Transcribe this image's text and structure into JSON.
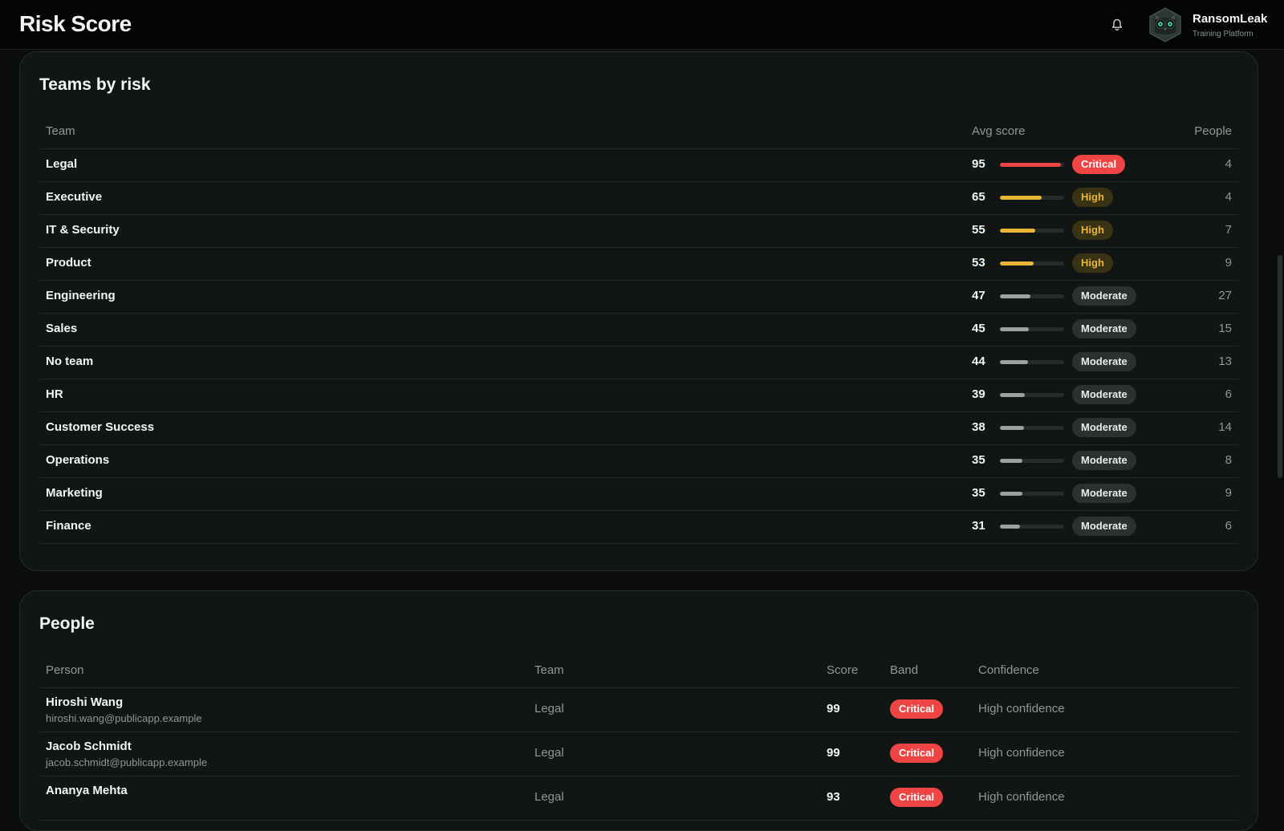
{
  "header": {
    "title": "Risk Score",
    "brand_name": "RansomLeak",
    "brand_sub": "Training Platform",
    "icons": [
      "bell-icon",
      "owl-logo-icon"
    ]
  },
  "colors": {
    "critical": "#ee4444",
    "high": "#e8b634",
    "moderate": "#9aa19e",
    "background": "#0a0d0c",
    "card": "#111614"
  },
  "teams": {
    "title": "Teams by risk",
    "columns": {
      "team": "Team",
      "avg_score": "Avg score",
      "people": "People"
    },
    "rows": [
      {
        "team": "Legal",
        "score": "95",
        "band": "Critical",
        "people": "4"
      },
      {
        "team": "Executive",
        "score": "65",
        "band": "High",
        "people": "4"
      },
      {
        "team": "IT & Security",
        "score": "55",
        "band": "High",
        "people": "7"
      },
      {
        "team": "Product",
        "score": "53",
        "band": "High",
        "people": "9"
      },
      {
        "team": "Engineering",
        "score": "47",
        "band": "Moderate",
        "people": "27"
      },
      {
        "team": "Sales",
        "score": "45",
        "band": "Moderate",
        "people": "15"
      },
      {
        "team": "No team",
        "score": "44",
        "band": "Moderate",
        "people": "13"
      },
      {
        "team": "HR",
        "score": "39",
        "band": "Moderate",
        "people": "6"
      },
      {
        "team": "Customer Success",
        "score": "38",
        "band": "Moderate",
        "people": "14"
      },
      {
        "team": "Operations",
        "score": "35",
        "band": "Moderate",
        "people": "8"
      },
      {
        "team": "Marketing",
        "score": "35",
        "band": "Moderate",
        "people": "9"
      },
      {
        "team": "Finance",
        "score": "31",
        "band": "Moderate",
        "people": "6"
      }
    ]
  },
  "people": {
    "title": "People",
    "columns": {
      "person": "Person",
      "team": "Team",
      "score": "Score",
      "band": "Band",
      "confidence": "Confidence"
    },
    "rows": [
      {
        "name": "Hiroshi Wang",
        "email": "hiroshi.wang@publicapp.example",
        "team": "Legal",
        "score": "99",
        "band": "Critical",
        "confidence": "High confidence"
      },
      {
        "name": "Jacob Schmidt",
        "email": "jacob.schmidt@publicapp.example",
        "team": "Legal",
        "score": "99",
        "band": "Critical",
        "confidence": "High confidence"
      },
      {
        "name": "Ananya Mehta",
        "email": "",
        "team": "Legal",
        "score": "93",
        "band": "Critical",
        "confidence": "High confidence"
      }
    ]
  }
}
